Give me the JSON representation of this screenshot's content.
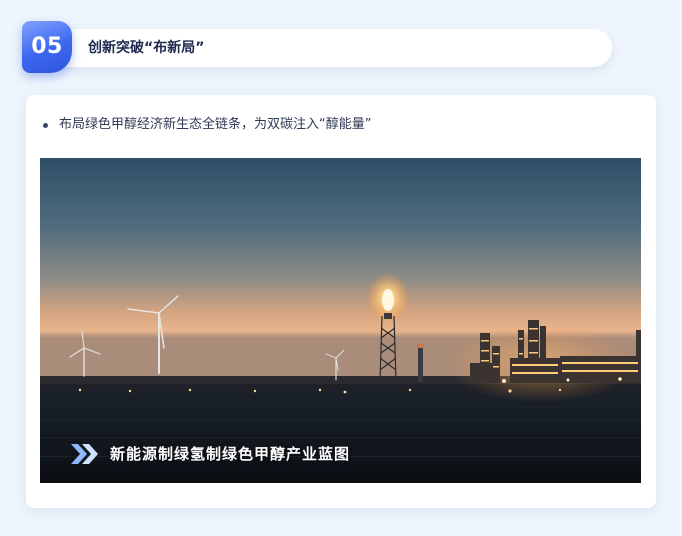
{
  "section": {
    "number": "05",
    "title": "创新突破“布新局”"
  },
  "content": {
    "bullet_text": "布局绿色甲醇经济新生态全链条，为双碳注入“醇能量”"
  },
  "photo": {
    "caption": "新能源制绿氢制绿色甲醇产业蓝图"
  },
  "colors": {
    "page_background": "#eef5fc",
    "badge_blue": "#3d66f0",
    "title_text": "#1f2a4f",
    "caption_chevron": "#8fb8ff"
  }
}
